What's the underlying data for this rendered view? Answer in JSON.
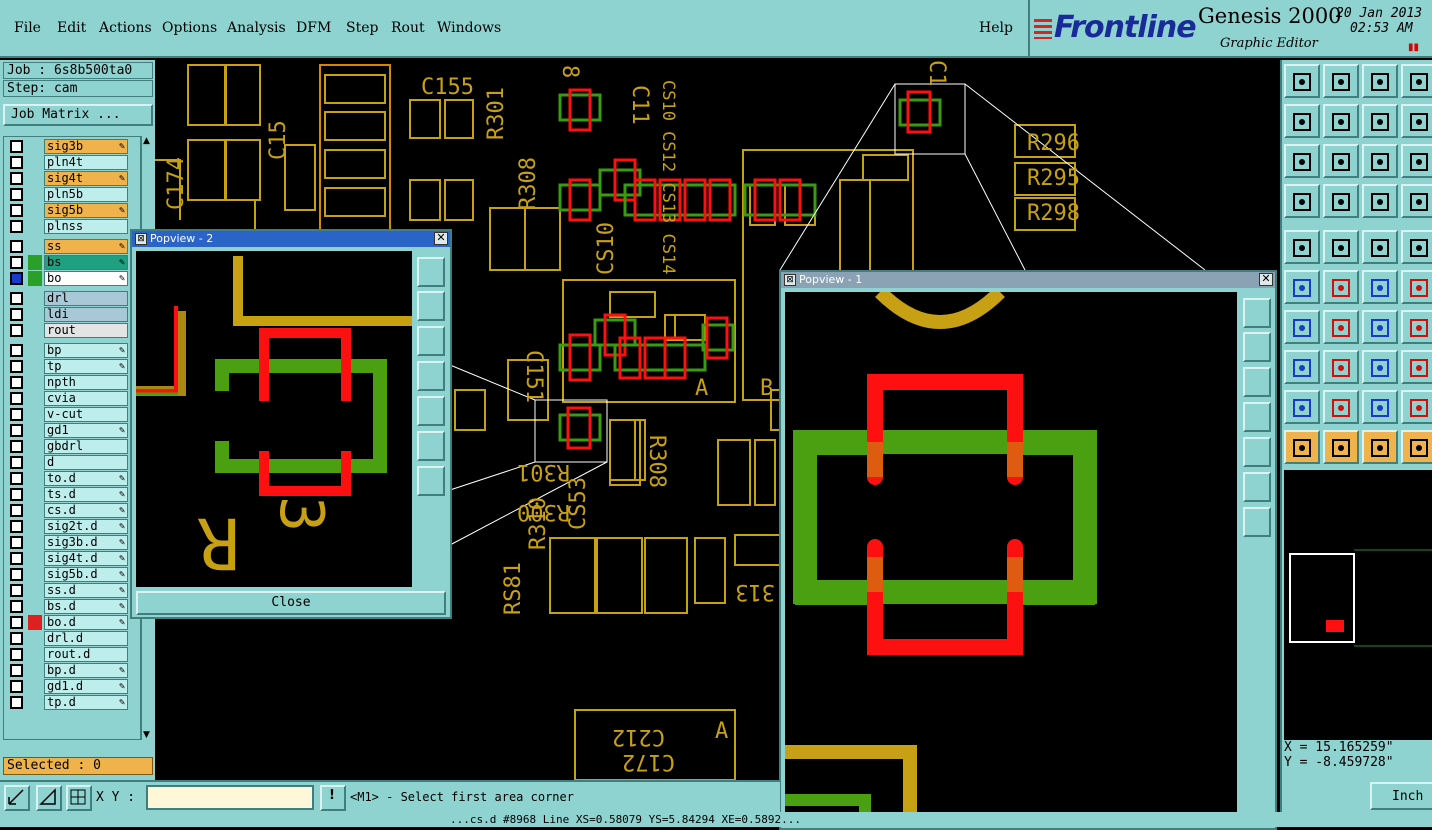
{
  "menu": {
    "items": [
      "File",
      "Edit",
      "Actions",
      "Options",
      "Analysis",
      "DFM",
      "Step",
      "Rout",
      "Windows"
    ],
    "help": "Help"
  },
  "brand": {
    "logo": "Frontline",
    "product": "Genesis 2000",
    "subtitle": "Graphic Editor",
    "date": "20 Jan 2013",
    "time": "02:53 AM"
  },
  "job": {
    "job_line": "Job : 6s8b500ta0",
    "step_line": "Step: cam",
    "matrix_button": "Job Matrix ..."
  },
  "layers": [
    {
      "name": "sig3b",
      "color": "#f0b24a",
      "edit": true
    },
    {
      "name": "pln4t",
      "color": "",
      "edit": false
    },
    {
      "name": "sig4t",
      "color": "#f0b24a",
      "edit": true
    },
    {
      "name": "pln5b",
      "color": "",
      "edit": false
    },
    {
      "name": "sig5b",
      "color": "#f0b24a",
      "edit": true
    },
    {
      "name": "plnss",
      "color": "",
      "edit": false
    },
    {
      "name": "ss",
      "color": "#f0b24a",
      "edit": true
    },
    {
      "name": "bs",
      "color": "#1fa080",
      "edit": true,
      "swatch": "#2aa02a"
    },
    {
      "name": "bo",
      "color": "#ffffff",
      "edit": true,
      "swatch": "#2aa02a",
      "active": true
    },
    {
      "name": "drl",
      "color": "#a8c8d8",
      "edit": false
    },
    {
      "name": "ldi",
      "color": "#a8c8d8",
      "edit": false
    },
    {
      "name": "rout",
      "color": "#e4e4e4",
      "edit": false
    },
    {
      "name": "bp",
      "color": "",
      "edit": true
    },
    {
      "name": "tp",
      "color": "",
      "edit": true
    },
    {
      "name": "npth",
      "color": "",
      "edit": false
    },
    {
      "name": "cvia",
      "color": "",
      "edit": false
    },
    {
      "name": "v-cut",
      "color": "",
      "edit": false
    },
    {
      "name": "gd1",
      "color": "",
      "edit": true
    },
    {
      "name": "gbdrl",
      "color": "",
      "edit": false
    },
    {
      "name": "d",
      "color": "",
      "edit": false
    },
    {
      "name": "to.d",
      "color": "",
      "edit": true
    },
    {
      "name": "ts.d",
      "color": "",
      "edit": true
    },
    {
      "name": "cs.d",
      "color": "",
      "edit": true
    },
    {
      "name": "sig2t.d",
      "color": "",
      "edit": true
    },
    {
      "name": "sig3b.d",
      "color": "",
      "edit": true
    },
    {
      "name": "sig4t.d",
      "color": "",
      "edit": true
    },
    {
      "name": "sig5b.d",
      "color": "",
      "edit": true
    },
    {
      "name": "ss.d",
      "color": "",
      "edit": true
    },
    {
      "name": "bs.d",
      "color": "",
      "edit": true
    },
    {
      "name": "bo.d",
      "color": "",
      "edit": true,
      "swatch": "#e02020"
    },
    {
      "name": "drl.d",
      "color": "",
      "edit": false
    },
    {
      "name": "rout.d",
      "color": "",
      "edit": false
    },
    {
      "name": "bp.d",
      "color": "",
      "edit": true
    },
    {
      "name": "gd1.d",
      "color": "",
      "edit": true
    },
    {
      "name": "tp.d",
      "color": "",
      "edit": true
    }
  ],
  "selected": "Selected : 0",
  "bottom": {
    "xy_label": "X Y :",
    "xy_value": "",
    "prompt": "<M1> - Select first area corner",
    "status": "...cs.d #8968 Line XS=0.58079 YS=5.84294 XE=0.5892..."
  },
  "coords": {
    "x": "X = 15.165259\"",
    "y": "Y = -8.459728\"",
    "unit": "Inch"
  },
  "popview2": {
    "title": "Popview - 2",
    "close_label": "Close"
  },
  "popview1": {
    "title": "Popview - 1"
  },
  "pcb_labels": {
    "c155": "C155",
    "r301": "R301",
    "r308": "R308",
    "c510": "CS10",
    "c151": "C151",
    "r296": "R296",
    "r295": "R295",
    "r298": "R298",
    "a1": "A",
    "b1": "B",
    "r300": "R300",
    "r301b": "R301",
    "cs53": "CS53",
    "r308b": "R308",
    "c212": "C212",
    "a2": "A",
    "c172": "C172",
    "c9": "8",
    "n313": "313",
    "c1": "C1",
    "r308c": "R308",
    "r310": "R310",
    "rs81": "RS81",
    "c15": "C15",
    "c174": "C174",
    "c11": "C11",
    "stack": "CS10 CS12 CS13 CS14"
  },
  "colors": {
    "panel": "#8fd3d0",
    "outline": "#c8a014",
    "pad_red": "#ff1010",
    "pad_green": "#4aa010"
  }
}
